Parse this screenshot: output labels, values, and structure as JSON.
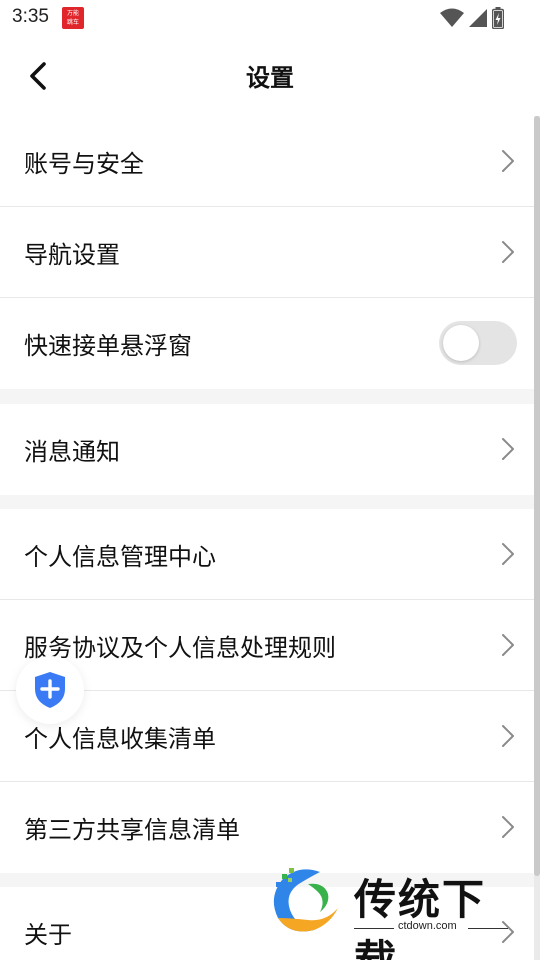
{
  "status_bar": {
    "time": "3:35",
    "badge_text": "万能\n跳车"
  },
  "header": {
    "title": "设置"
  },
  "groups": [
    {
      "items": [
        {
          "label": "账号与安全",
          "type": "link"
        },
        {
          "label": "导航设置",
          "type": "link"
        },
        {
          "label": "快速接单悬浮窗",
          "type": "toggle",
          "enabled": false
        }
      ]
    },
    {
      "items": [
        {
          "label": "消息通知",
          "type": "link"
        }
      ]
    },
    {
      "items": [
        {
          "label": "个人信息管理中心",
          "type": "link"
        },
        {
          "label": "服务协议及个人信息处理规则",
          "type": "link"
        },
        {
          "label": "个人信息收集清单",
          "type": "link"
        },
        {
          "label": "第三方共享信息清单",
          "type": "link"
        }
      ]
    },
    {
      "items": [
        {
          "label": "关于",
          "type": "link"
        }
      ]
    }
  ],
  "watermark": {
    "title": "传统下载",
    "subtitle": "ctdown.com"
  },
  "colors": {
    "accent_blue": "#3a7bf5",
    "separator": "#f5f5f5",
    "toggle_off": "#e4e4e4"
  },
  "icons": {
    "back": "chevron-left-icon",
    "row": "chevron-right-icon",
    "floating": "shield-plus-icon"
  }
}
